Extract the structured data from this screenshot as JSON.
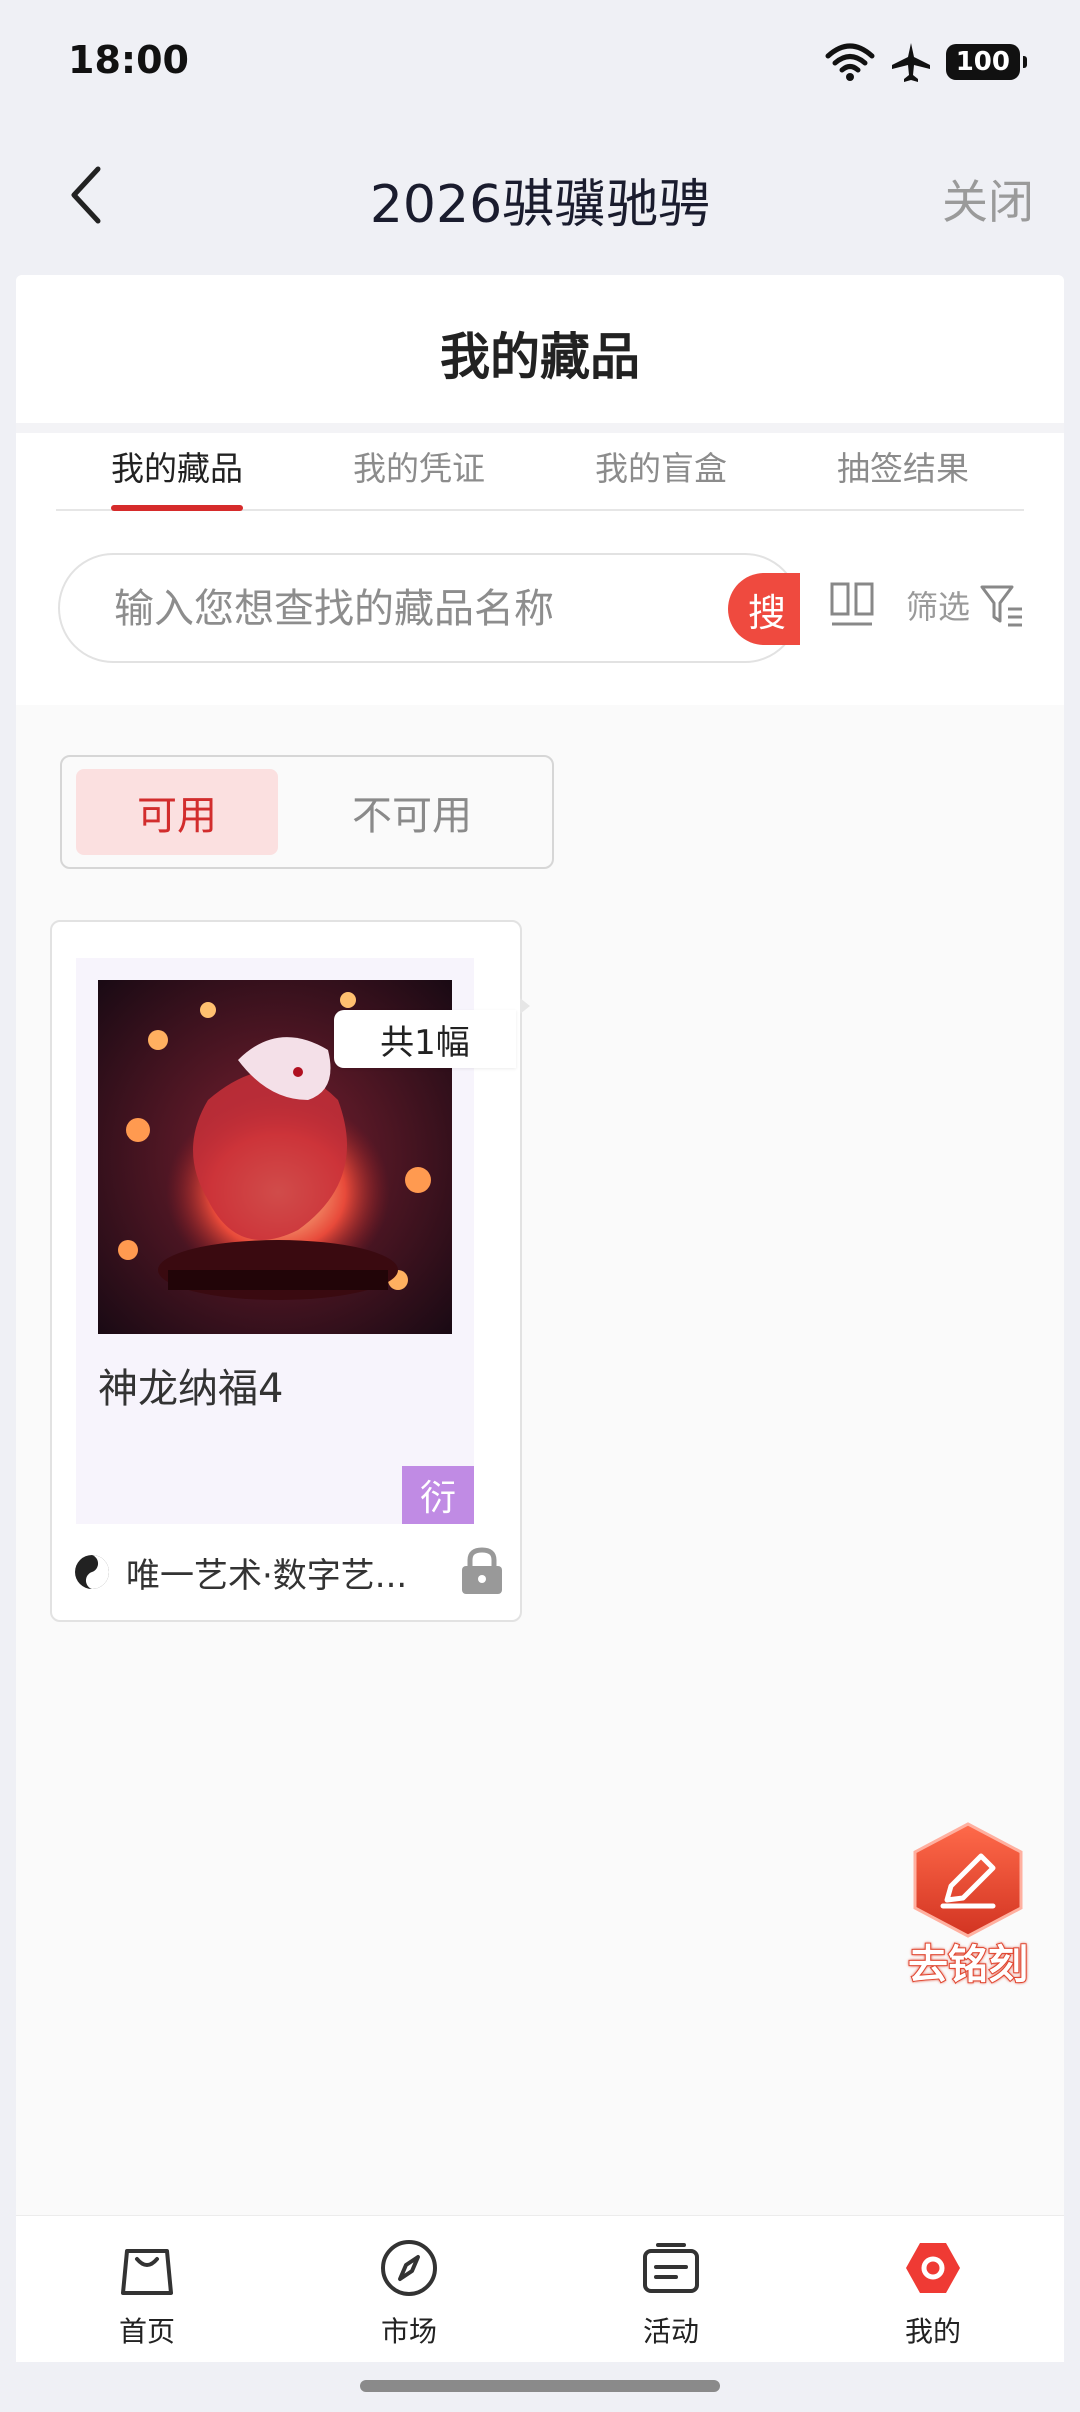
{
  "status_bar": {
    "time": "18:00",
    "battery": "100"
  },
  "nav": {
    "title": "2026骐骥驰骋",
    "close_label": "关闭"
  },
  "page": {
    "title": "我的藏品"
  },
  "tabs": [
    {
      "label": "我的藏品",
      "active": true
    },
    {
      "label": "我的凭证",
      "active": false
    },
    {
      "label": "我的盲盒",
      "active": false
    },
    {
      "label": "抽签结果",
      "active": false
    }
  ],
  "search": {
    "placeholder": "输入您想查找的藏品名称",
    "button_label": "搜",
    "filter_label": "筛选"
  },
  "availability": {
    "available_label": "可用",
    "unavailable_label": "不可用",
    "selected": "可用"
  },
  "collection": [
    {
      "name": "神龙纳福4",
      "count_label": "共1幅",
      "tag": "衍",
      "publisher": "唯一艺术·数字艺...",
      "locked": true
    }
  ],
  "floating": {
    "engrave_label": "去铭刻"
  },
  "bottom_nav": [
    {
      "label": "首页",
      "icon": "bag-icon"
    },
    {
      "label": "市场",
      "icon": "compass-icon"
    },
    {
      "label": "活动",
      "icon": "ticket-icon"
    },
    {
      "label": "我的",
      "icon": "profile-icon",
      "active": true
    }
  ],
  "colors": {
    "accent": "#d62b2b",
    "tag": "#c08be4",
    "engrave": "#e0452f"
  }
}
